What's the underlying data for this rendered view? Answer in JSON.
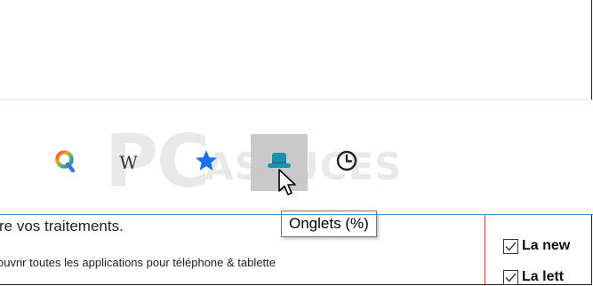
{
  "watermark": {
    "main": "PC",
    "sub": "ASTUCES"
  },
  "toolbar": {
    "icons": {
      "qwant": "qwant-icon",
      "wikipedia": "wikipedia-icon",
      "favorites": "star-icon",
      "tabs": "hat-icon",
      "history": "clock-icon"
    },
    "wikipedia_label": "W"
  },
  "tooltip": {
    "text": "Onglets (%)"
  },
  "content": {
    "line1": "re vos traitements.",
    "line2": "ouvrir toutes les applications pour téléphone & tablette"
  },
  "sidebar": {
    "items": [
      {
        "label": "La new",
        "checked": true
      },
      {
        "label": "La lett",
        "checked": true
      }
    ]
  },
  "colors": {
    "accent_blue": "#1a73e8",
    "tabs_icon": "#1f8fb0",
    "tabs_bg": "#c9c9c9",
    "content_line": "#4b8fd6",
    "separator_red": "#c0392b"
  }
}
